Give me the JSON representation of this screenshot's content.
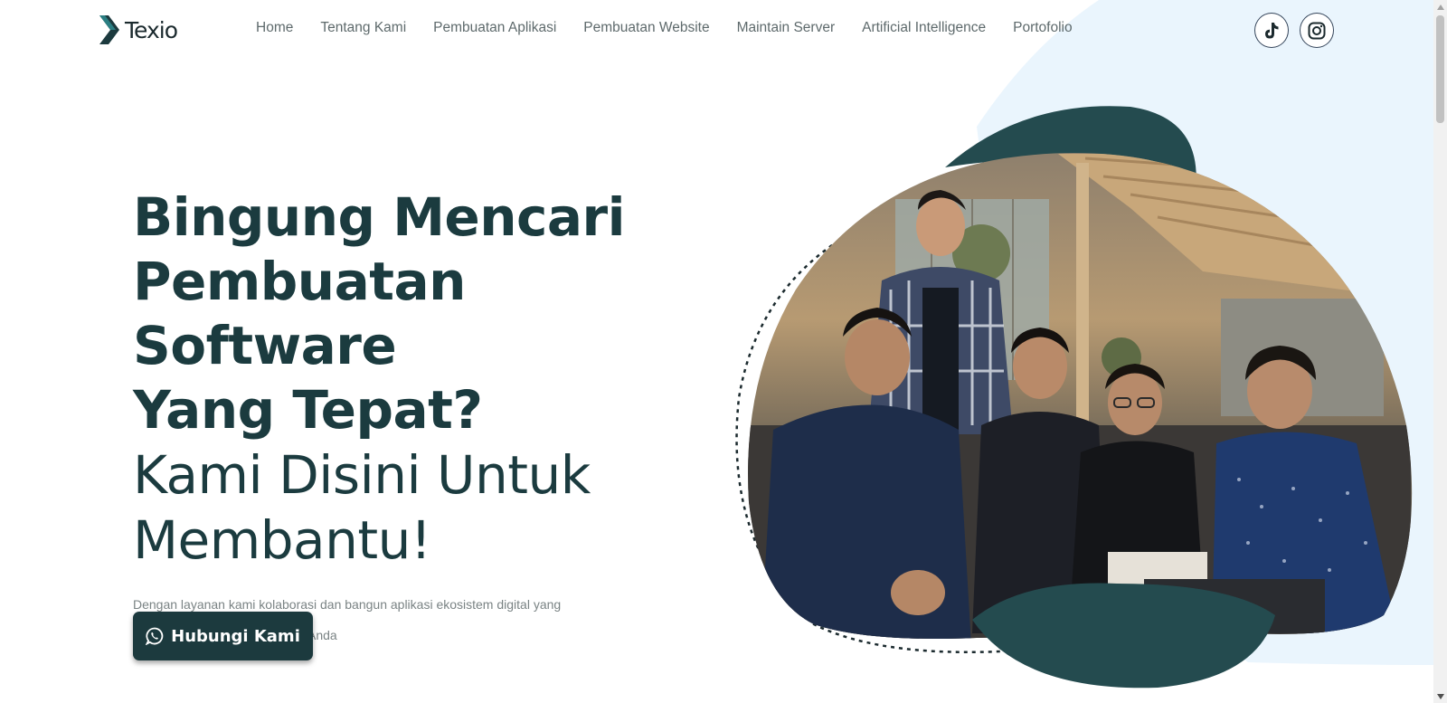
{
  "brand": {
    "name": "Texio"
  },
  "nav": {
    "items": [
      {
        "label": "Home"
      },
      {
        "label": "Tentang Kami"
      },
      {
        "label": "Pembuatan Aplikasi"
      },
      {
        "label": "Pembuatan Website"
      },
      {
        "label": "Maintain Server"
      },
      {
        "label": "Artificial Intelligence"
      },
      {
        "label": "Portofolio"
      }
    ]
  },
  "social": {
    "tiktok_icon": "tiktok-icon",
    "instagram_icon": "instagram-icon"
  },
  "hero": {
    "headline_bold": [
      "Bingung Mencari",
      "Pembuatan Software",
      "Yang Tepat?"
    ],
    "headline_light": [
      "Kami Disini Untuk",
      "Membantu!"
    ],
    "description": "Dengan layanan kami kolaborasi dan bangun aplikasi ekosistem digital yang inovatif dan solutif untuk bisnis Anda",
    "cta_label": "Hubungi Kami",
    "cta_icon": "whatsapp-icon"
  },
  "colors": {
    "primary": "#1c3a3e",
    "accent_teal": "#244b4f",
    "bg_light_blue": "#eaf5fd",
    "text_muted": "#7a8384"
  }
}
